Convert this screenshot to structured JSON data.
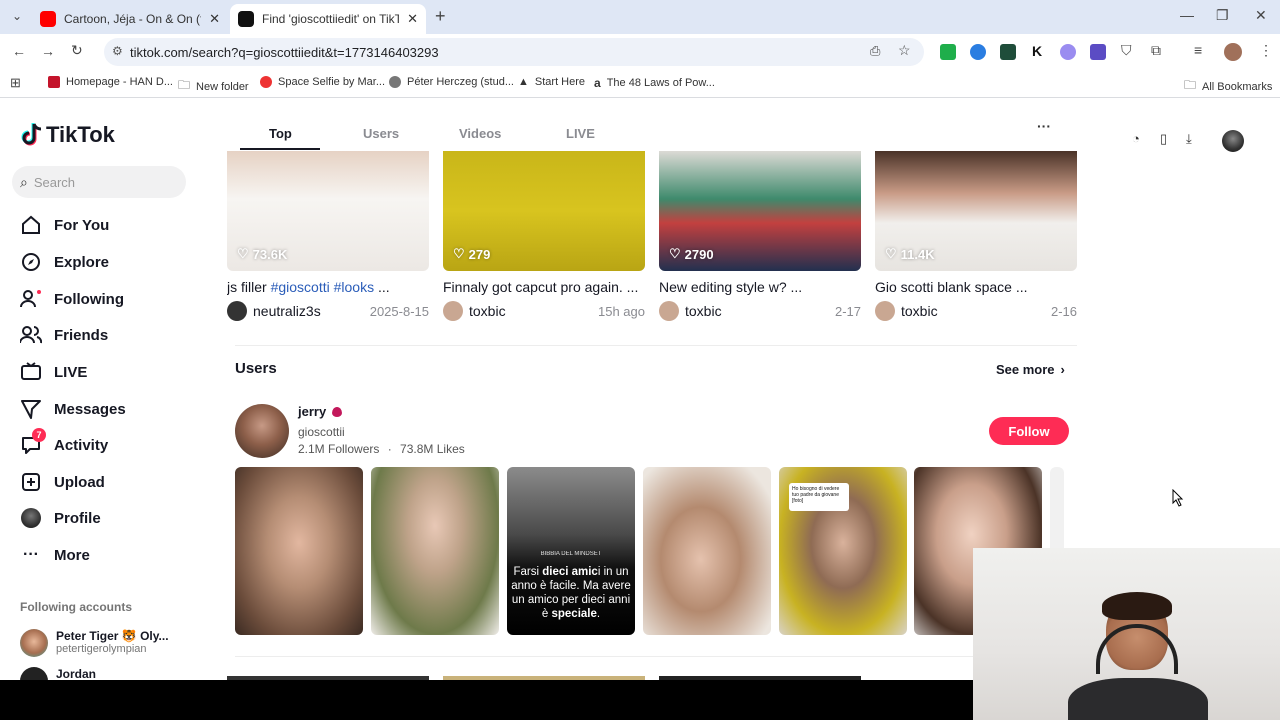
{
  "browser": {
    "tabs": [
      {
        "title": "Cartoon, Jéja - On & On (feat. D",
        "active": false
      },
      {
        "title": "Find 'gioscottiiedit' on TikTok | T",
        "active": true
      }
    ],
    "new_tab_glyph": "+",
    "url": "tiktok.com/search?q=gioscottiiedit&t=1773146403293",
    "bookmarks": [
      {
        "label": "Homepage - HAN D..."
      },
      {
        "label": "New folder"
      },
      {
        "label": "Space Selfie by Mar..."
      },
      {
        "label": "Péter Herczeg (stud..."
      },
      {
        "label": "Start Here"
      },
      {
        "label": "The 48 Laws of Pow..."
      }
    ],
    "all_bookmarks": "All Bookmarks"
  },
  "tiktok": {
    "logo_text": "TikTok",
    "search_placeholder": "Search",
    "nav": [
      {
        "label": "For You",
        "icon": "home-icon"
      },
      {
        "label": "Explore",
        "icon": "compass-icon"
      },
      {
        "label": "Following",
        "icon": "following-icon"
      },
      {
        "label": "Friends",
        "icon": "friends-icon"
      },
      {
        "label": "LIVE",
        "icon": "live-icon"
      },
      {
        "label": "Messages",
        "icon": "messages-icon"
      },
      {
        "label": "Activity",
        "icon": "activity-icon",
        "badge": "7"
      },
      {
        "label": "Upload",
        "icon": "upload-icon"
      },
      {
        "label": "Profile",
        "icon": "profile-icon"
      },
      {
        "label": "More",
        "icon": "more-icon"
      }
    ],
    "following_title": "Following accounts",
    "following_accounts": [
      {
        "name": "Peter Tiger 🐯 Oly...",
        "handle": "petertigerolympian"
      },
      {
        "name": "Jordan",
        "handle": ""
      }
    ],
    "search_tabs": [
      "Top",
      "Users",
      "Videos",
      "LIVE"
    ],
    "more_glyph": "···",
    "videos": [
      {
        "likes": "73.6K",
        "title": "js filler",
        "tags": "#gioscotti #looks",
        "ellipsis": " ...",
        "author": "neutraliz3s",
        "date": "2025-8-15",
        "color": "#e9e6e3"
      },
      {
        "likes": "279",
        "title": "Finnaly got capcut pro again. ...",
        "tags": "",
        "ellipsis": "",
        "author": "toxbic",
        "date": "15h ago",
        "color": "#cdbb1e"
      },
      {
        "likes": "2790",
        "title": "New editing style w? ...",
        "tags": "",
        "ellipsis": "",
        "author": "toxbic",
        "date": "2-17",
        "color": "#6b8a76"
      },
      {
        "likes": "11.4K",
        "title": "Gio scotti blank space ...",
        "tags": "",
        "ellipsis": "",
        "author": "toxbic",
        "date": "2-16",
        "color": "#d4c6bd"
      }
    ],
    "users_section": {
      "heading": "Users",
      "see_more": "See more",
      "user": {
        "name": "jerry",
        "handle": "gioscottii",
        "followers": "2.1M Followers",
        "separator": "·",
        "likes": "73.8M Likes",
        "follow_label": "Follow"
      },
      "photos": [
        {
          "color": "#b58d74"
        },
        {
          "color": "#8a7a63"
        },
        {
          "color": "#3a3a3a",
          "label": "BIBBIA DEL MINDSET",
          "text_plain1": "Farsi ",
          "text_bold1": "dieci amic",
          "text_plain2": "i in un anno è facile. Ma avere un amico per dieci anni ",
          "text_plain3": "è ",
          "text_bold2": "speciale",
          "text_plain4": "."
        },
        {
          "color": "#c9b6a8"
        },
        {
          "color": "#c8b222",
          "bubble": "Ho bisogno di vedere tuo padre da giovane [foto]"
        },
        {
          "color": "#d9c3b6"
        }
      ]
    }
  },
  "accent": {
    "tiktok_red": "#fe2c55",
    "hashtag_blue": "#2b5db9"
  }
}
